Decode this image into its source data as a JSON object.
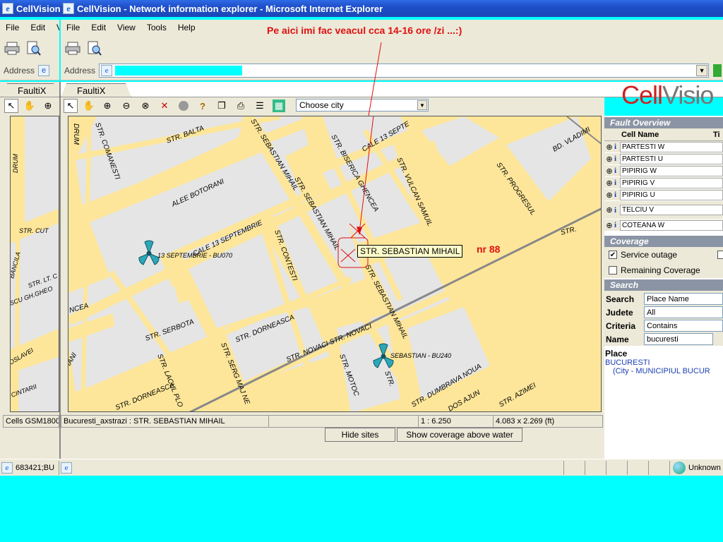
{
  "window": {
    "back_title_fragment": "CellVision",
    "title": "CellVision - Network information explorer - Microsoft Internet Explorer"
  },
  "menu": {
    "back_items": [
      "File",
      "Edit",
      "Vi"
    ],
    "items": [
      "File",
      "Edit",
      "View",
      "Tools",
      "Help"
    ]
  },
  "address": {
    "label": "Address",
    "value": ""
  },
  "tabs": {
    "back": "FaultiX",
    "front": "FaultiX"
  },
  "brand": {
    "prefix": "Cell",
    "suffix": "Visio",
    "accent": "#cc2222"
  },
  "map_toolbar": {
    "city_select": "Choose city",
    "tools": [
      "select-arrow-icon",
      "hand-pan-icon",
      "zoom-in-icon",
      "zoom-out-icon",
      "zoom-extent-icon",
      "zoom-cancel-icon",
      "circle-icon",
      "help-question-icon",
      "copy-icon",
      "print-icon",
      "list-icon",
      "map-layer-icon"
    ]
  },
  "annotation": {
    "comment": "Pe aici imi fac veacul cca 14-16 ore /zi ...:)",
    "nr": "nr 88",
    "color": "#e01010"
  },
  "map": {
    "colors": {
      "block": "#e5e5e5",
      "road": "#fde69a",
      "road_edge": "#e0c870",
      "railway": "#888888"
    },
    "tooltip": "STR.  SEBASTIAN MIHAIL",
    "streets": [
      "STR. BALTA",
      "STR. COMANESTI",
      "DRUM",
      "STR. BISERICA GHENCEA",
      "CALE 13 SEPTE",
      "STR. SEBASTIAN MIHAIL",
      "STR. VULCAN SAMUIL",
      "STR. PROGRESUL",
      "BD. VLADIMI",
      "ALEE BOTORANI",
      "CALE 13 SEPTEMBRIE",
      "STR. CONTESTI",
      "STR. SEBASTIAN MIHAIL",
      "STR.",
      "STR. SEBASTIAN MIHAIL",
      "STR. SERBOTA",
      "STR. DORNEASCA",
      "STR. NOVACI STR. NOVACI",
      "STR. LACUL PLO",
      "STR. SERG MAJ NE",
      "STR. MOTOC",
      "STR.",
      "STR. DUMBRAVA NOUA",
      "DOS AJUN",
      "STR. AZIMEI",
      "STR. DORNEASCA",
      "NCEA",
      "STR. CUT",
      "BANCILA",
      "STR. LT. C",
      "SCU GH.GHEO",
      "OSLAVEI",
      "CINTARII",
      "IANI"
    ],
    "sites": [
      "13 SEPTEMBRIE - BU070",
      "SEBASTIAN - BU240"
    ]
  },
  "status": {
    "left": "Cells GSM1800 :",
    "location": "Bucuresti_axstrazi : STR.  SEBASTIAN MIHAIL",
    "scale": "1 : 6.250",
    "size": "4.083 x 2.269 (ft)"
  },
  "buttons": {
    "hide_sites": "Hide sites",
    "show_coverage": "Show coverage above water"
  },
  "fault_overview": {
    "title": "Fault Overview",
    "col_name": "Cell Name",
    "col_ti": "Ti",
    "rows": [
      "PARTESTI W",
      "PARTESTI U",
      "PIPIRIG W",
      "PIPIRIG V",
      "PIPIRIG U",
      "TELCIU V",
      "COTEANA W"
    ]
  },
  "coverage": {
    "title": "Coverage",
    "service_outage": "Service outage",
    "service_outage_checked": true,
    "remaining": "Remaining Coverage",
    "remaining_checked": false
  },
  "search": {
    "title": "Search",
    "fields": [
      {
        "label": "Search",
        "value": "Place Name"
      },
      {
        "label": "Judete",
        "value": "All"
      },
      {
        "label": "Criteria",
        "value": "Contains"
      },
      {
        "label": "Name",
        "value": "bucuresti"
      }
    ],
    "result_header": "Place",
    "result_name": "BUCURESTI",
    "result_detail": "(City - MUNICIPIUL BUCUR"
  },
  "taskbar": {
    "back_item": "683421;BU",
    "zone": "Unknown"
  }
}
